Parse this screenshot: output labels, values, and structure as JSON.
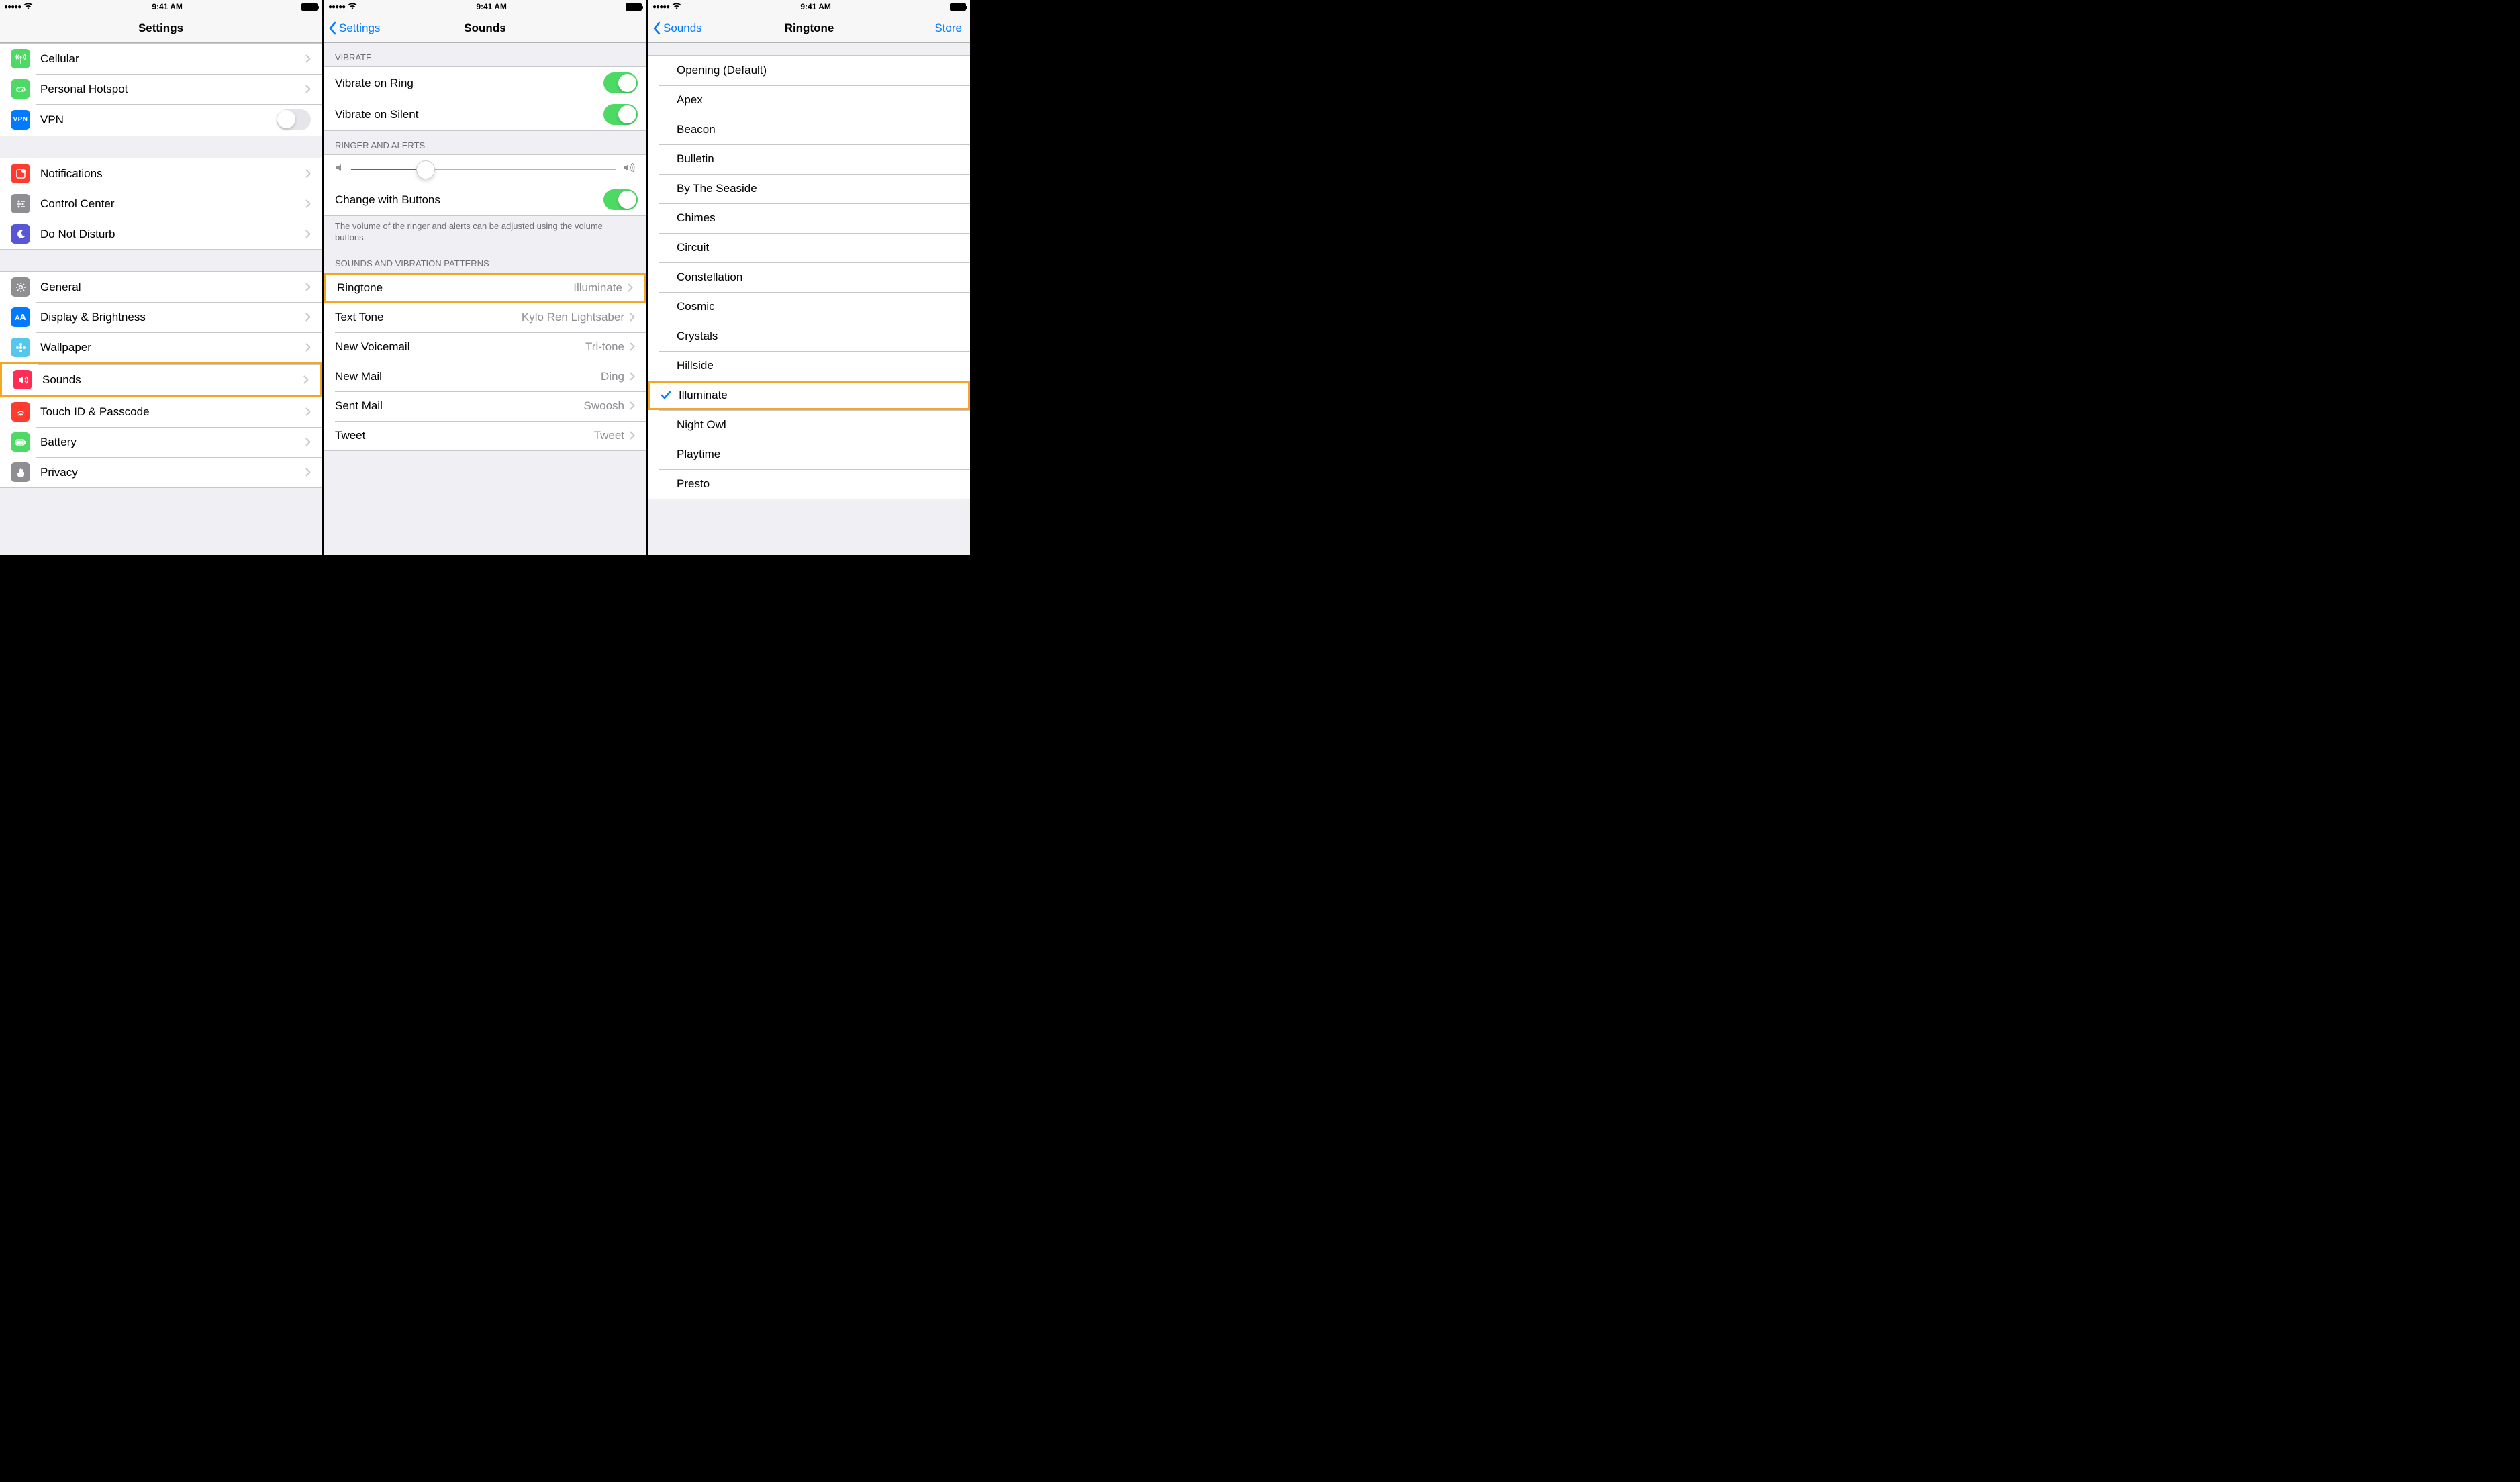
{
  "status": {
    "time": "9:41 AM"
  },
  "colors": {
    "green": "#4cd964",
    "red": "#ff3b30",
    "orange": "#ff9500",
    "blue": "#007aff",
    "gray": "#8e8e93",
    "purple": "#5856d6",
    "grayIcon": "#8e8e93"
  },
  "screen1": {
    "title": "Settings",
    "groups": [
      {
        "items": [
          {
            "id": "cellular",
            "label": "Cellular",
            "icon_color": "#4cd964",
            "icon": "antenna"
          },
          {
            "id": "hotspot",
            "label": "Personal Hotspot",
            "icon_color": "#4cd964",
            "icon": "link"
          },
          {
            "id": "vpn",
            "label": "VPN",
            "icon_color": "#007aff",
            "icon": "vpn",
            "toggle": false
          }
        ]
      },
      {
        "items": [
          {
            "id": "notifications",
            "label": "Notifications",
            "icon_color": "#ff3b30",
            "icon": "notif"
          },
          {
            "id": "control-center",
            "label": "Control Center",
            "icon_color": "#8e8e93",
            "icon": "cc"
          },
          {
            "id": "dnd",
            "label": "Do Not Disturb",
            "icon_color": "#5856d6",
            "icon": "moon"
          }
        ]
      },
      {
        "items": [
          {
            "id": "general",
            "label": "General",
            "icon_color": "#8e8e93",
            "icon": "gear"
          },
          {
            "id": "display",
            "label": "Display & Brightness",
            "icon_color": "#007aff",
            "icon": "aa"
          },
          {
            "id": "wallpaper",
            "label": "Wallpaper",
            "icon_color": "#54c7ec",
            "icon": "flower"
          },
          {
            "id": "sounds",
            "label": "Sounds",
            "icon_color": "#ff2d55",
            "icon": "speaker",
            "highlight": true
          },
          {
            "id": "touchid",
            "label": "Touch ID & Passcode",
            "icon_color": "#ff3b30",
            "icon": "finger"
          },
          {
            "id": "battery",
            "label": "Battery",
            "icon_color": "#4cd964",
            "icon": "batt"
          },
          {
            "id": "privacy",
            "label": "Privacy",
            "icon_color": "#8e8e93",
            "icon": "hand"
          }
        ]
      }
    ]
  },
  "screen2": {
    "back": "Settings",
    "title": "Sounds",
    "section_vibrate": "VIBRATE",
    "vibrate_ring": "Vibrate on Ring",
    "vibrate_silent": "Vibrate on Silent",
    "section_ringer": "RINGER AND ALERTS",
    "change_buttons": "Change with Buttons",
    "footer": "The volume of the ringer and alerts can be adjusted using the volume buttons.",
    "section_sounds": "SOUNDS AND VIBRATION PATTERNS",
    "rows": [
      {
        "id": "ringtone",
        "label": "Ringtone",
        "value": "Illuminate",
        "highlight": true
      },
      {
        "id": "texttone",
        "label": "Text Tone",
        "value": "Kylo Ren Lightsaber"
      },
      {
        "id": "voicemail",
        "label": "New Voicemail",
        "value": "Tri-tone"
      },
      {
        "id": "newmail",
        "label": "New Mail",
        "value": "Ding"
      },
      {
        "id": "sentmail",
        "label": "Sent Mail",
        "value": "Swoosh"
      },
      {
        "id": "tweet",
        "label": "Tweet",
        "value": "Tweet"
      }
    ]
  },
  "screen3": {
    "back": "Sounds",
    "title": "Ringtone",
    "right": "Store",
    "tones": [
      {
        "label": "Opening (Default)"
      },
      {
        "label": "Apex"
      },
      {
        "label": "Beacon"
      },
      {
        "label": "Bulletin"
      },
      {
        "label": "By The Seaside"
      },
      {
        "label": "Chimes"
      },
      {
        "label": "Circuit"
      },
      {
        "label": "Constellation"
      },
      {
        "label": "Cosmic"
      },
      {
        "label": "Crystals"
      },
      {
        "label": "Hillside"
      },
      {
        "label": "Illuminate",
        "selected": true,
        "highlight": true
      },
      {
        "label": "Night Owl"
      },
      {
        "label": "Playtime"
      },
      {
        "label": "Presto"
      }
    ]
  }
}
